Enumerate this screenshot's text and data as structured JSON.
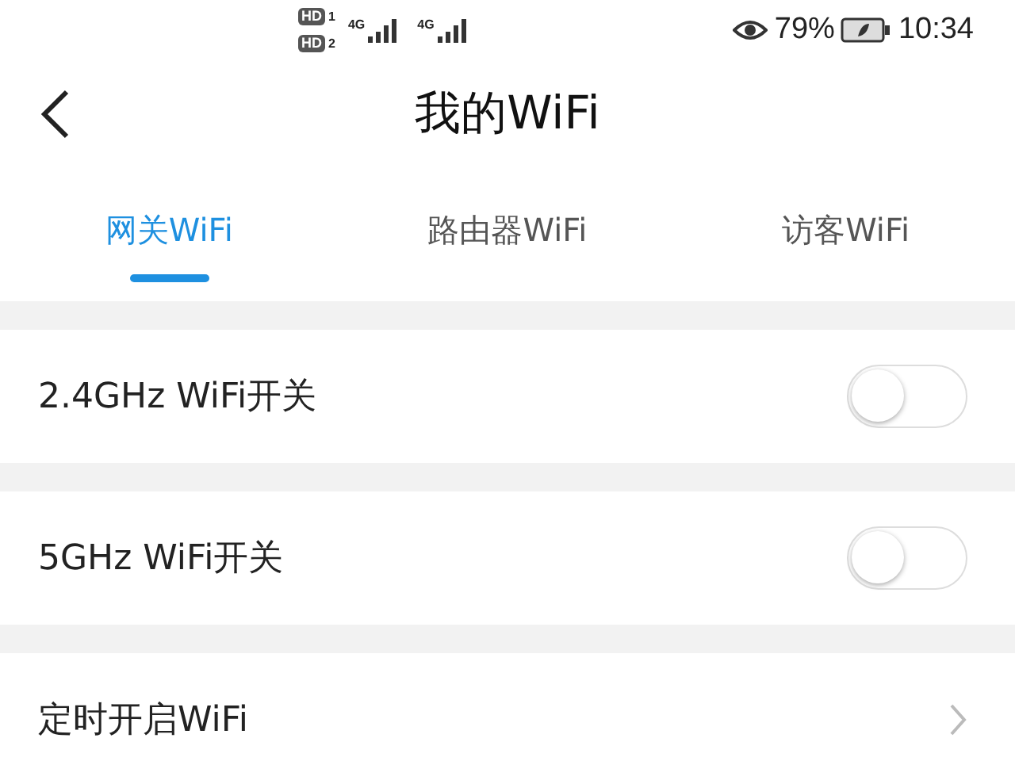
{
  "status_bar": {
    "sims": [
      {
        "badge": "HD",
        "slot": "1",
        "network": "4G"
      },
      {
        "badge": "HD",
        "slot": "2",
        "network": "4G"
      }
    ],
    "battery_percent": "79%",
    "time": "10:34"
  },
  "header": {
    "title": "我的WiFi"
  },
  "tabs": [
    {
      "label": "网关WiFi",
      "selected": true
    },
    {
      "label": "路由器WiFi",
      "selected": false
    },
    {
      "label": "访客WiFi",
      "selected": false
    }
  ],
  "settings": [
    {
      "kind": "toggle",
      "label": "2.4GHz WiFi开关",
      "on": false
    },
    {
      "kind": "toggle",
      "label": "5GHz WiFi开关",
      "on": false
    },
    {
      "kind": "link",
      "label": "定时开启WiFi"
    }
  ]
}
